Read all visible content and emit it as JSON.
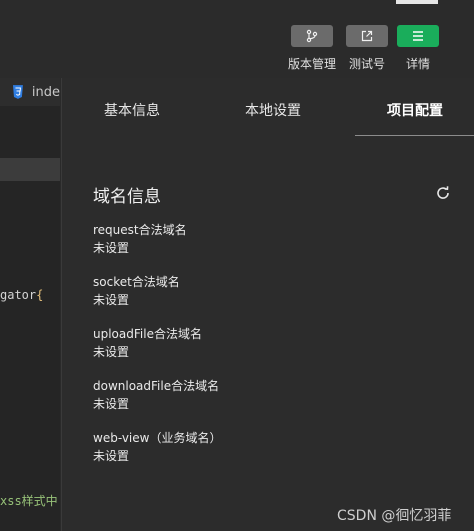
{
  "toolbar": {
    "buttons": [
      {
        "label": "版本管理",
        "icon": "branch-icon"
      },
      {
        "label": "测试号",
        "icon": "external-link-icon"
      },
      {
        "label": "详情",
        "icon": "menu-icon"
      }
    ]
  },
  "editor": {
    "file_tab": "inde",
    "code_fragment_1": "gator",
    "code_fragment_1_brace": "{",
    "code_fragment_2": "xss样式中"
  },
  "panel": {
    "tabs": [
      "基本信息",
      "本地设置",
      "项目配置"
    ],
    "active_tab": "项目配置",
    "section_title": "域名信息",
    "items": [
      {
        "label": "request合法域名",
        "value": "未设置"
      },
      {
        "label": "socket合法域名",
        "value": "未设置"
      },
      {
        "label": "uploadFile合法域名",
        "value": "未设置"
      },
      {
        "label": "downloadFile合法域名",
        "value": "未设置"
      },
      {
        "label": "web-view（业务域名）",
        "value": "未设置"
      }
    ]
  },
  "watermark": "CSDN @徊忆羽菲",
  "colors": {
    "accent_green": "#1aad5b",
    "button_gray": "#6b6b6b",
    "panel_bg": "#2c2c2c",
    "css_icon": "#2f7de1",
    "code_yellow": "#e5c07b",
    "code_green": "#98c379"
  }
}
